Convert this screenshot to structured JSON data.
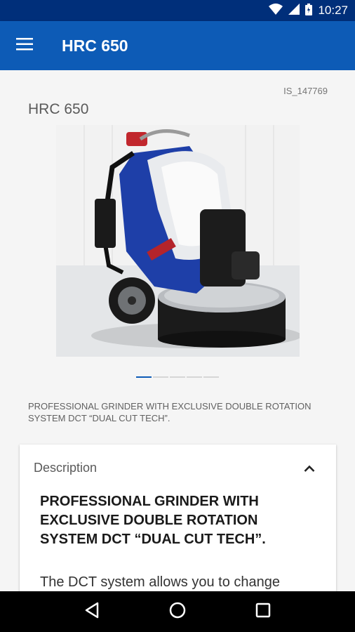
{
  "status_bar": {
    "time": "10:27",
    "icons": [
      "wifi-icon",
      "signal-icon",
      "battery-icon"
    ]
  },
  "app_bar": {
    "title": "HRC 650",
    "menu_icon": "menu-icon"
  },
  "product": {
    "code": "IS_147769",
    "name": "HRC 650",
    "image_alt": "HRC 650 floor grinder",
    "pager": {
      "count": 5,
      "active": 0
    },
    "subtitle": "PROFESSIONAL GRINDER WITH EXCLUSIVE DOUBLE ROTATION SYSTEM DCT “DUAL CUT TECH”."
  },
  "description": {
    "label": "Description",
    "heading": "PROFESSIONAL GRINDER WITH EXCLUSIVE DOUBLE ROTATION SYSTEM DCT “DUAL CUT TECH”.",
    "body": "The DCT system allows you to change",
    "expanded": true
  },
  "nav_bar": {
    "buttons": [
      "back-icon",
      "home-icon",
      "recents-icon"
    ]
  },
  "colors": {
    "status_bar": "#002f7a",
    "app_bar": "#0d5bb6",
    "accent": "#0d5bb6"
  }
}
